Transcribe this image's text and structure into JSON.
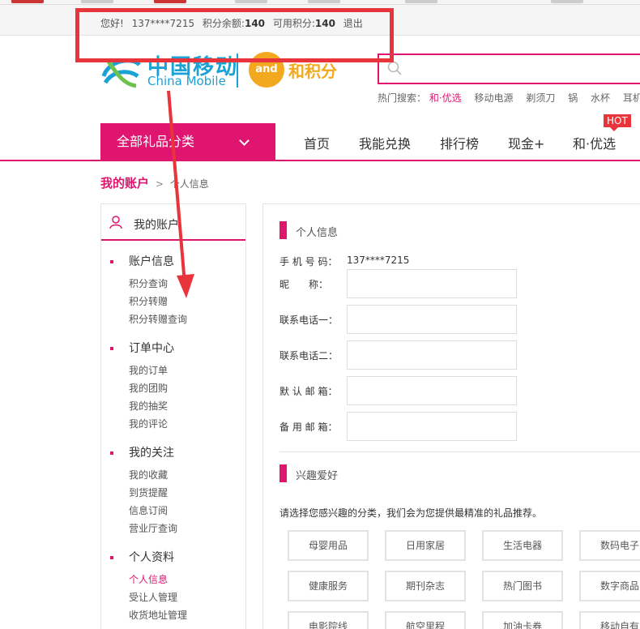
{
  "topbar": {
    "greeting": "您好!",
    "phone": "137****7215",
    "points_balance_label": "积分余额:",
    "points_balance_value": "140",
    "available_points_label": "可用积分:",
    "available_points_value": "140",
    "logout": "退出"
  },
  "logo": {
    "cm_cn": "中国移动",
    "cm_en": "China Mobile",
    "hejf_icon_text": "and",
    "hejf_text": "和积分"
  },
  "search": {
    "placeholder": "",
    "hot_label": "热门搜索：",
    "hot_items": [
      "和·优选",
      "移动电源",
      "剃须刀",
      "锅",
      "水杯",
      "耳机"
    ]
  },
  "nav": {
    "category_button": "全部礼品分类",
    "items": [
      "首页",
      "我能兑换",
      "排行榜",
      "现金+",
      "和·优选"
    ],
    "hot_badge": "HOT"
  },
  "breadcrumb": {
    "main": "我的账户",
    "separator": ">",
    "current": "个人信息"
  },
  "sidebar": {
    "header": "我的账户",
    "groups": [
      {
        "title": "账户信息",
        "links": [
          "积分查询",
          "积分转赠",
          "积分转赠查询"
        ]
      },
      {
        "title": "订单中心",
        "links": [
          "我的订单",
          "我的团购",
          "我的抽奖",
          "我的评论"
        ]
      },
      {
        "title": "我的关注",
        "links": [
          "我的收藏",
          "到货提醒",
          "信息订阅",
          "营业厅查询"
        ]
      },
      {
        "title": "个人资料",
        "links": [
          "个人信息",
          "受让人管理",
          "收货地址管理"
        ]
      }
    ]
  },
  "personal_info": {
    "section_title": "个人信息",
    "phone_label": "手 机 号 码：",
    "phone_value": "137****7215",
    "nickname_label": "昵　　称：",
    "contact1_label": "联系电话一：",
    "contact2_label": "联系电话二：",
    "default_email_label": "默 认 邮 箱：",
    "backup_email_label": "备 用 邮 箱："
  },
  "interests": {
    "section_title": "兴趣爱好",
    "description": "请选择您感兴趣的分类，我们会为您提供最精准的礼品推荐。",
    "tags": [
      "母婴用品",
      "日用家居",
      "生活电器",
      "数码电子",
      "健康服务",
      "期刊杂志",
      "热门图书",
      "数字商品",
      "电影院线",
      "航空里程",
      "加油卡券",
      "移动自有"
    ]
  },
  "colors": {
    "brand_pink": "#e0156f",
    "china_mobile_blue": "#1aa1d6",
    "hejf_orange": "#f2a91f",
    "annotation_red": "#e8343a"
  }
}
